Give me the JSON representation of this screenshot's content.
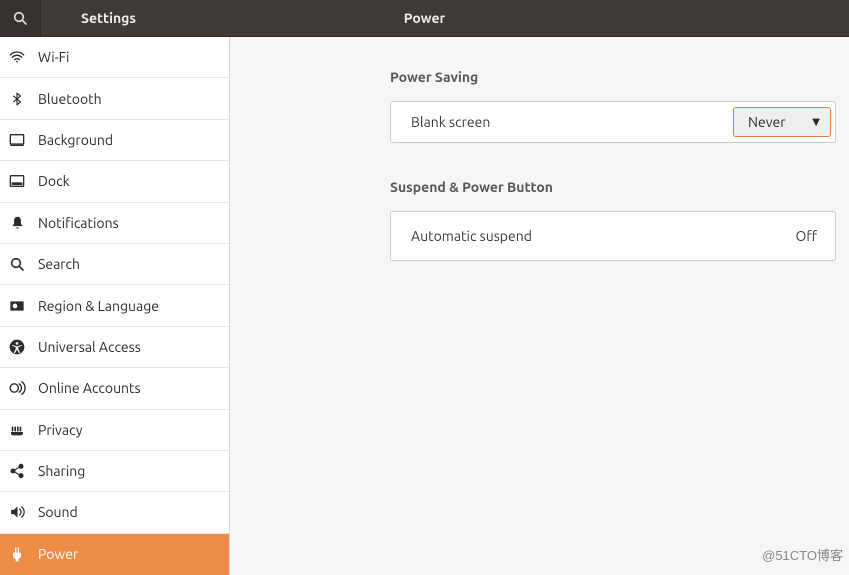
{
  "header": {
    "app_title": "Settings",
    "panel_title": "Power"
  },
  "sidebar": {
    "items": [
      {
        "label": "Wi-Fi"
      },
      {
        "label": "Bluetooth"
      },
      {
        "label": "Background"
      },
      {
        "label": "Dock"
      },
      {
        "label": "Notifications"
      },
      {
        "label": "Search"
      },
      {
        "label": "Region & Language"
      },
      {
        "label": "Universal Access"
      },
      {
        "label": "Online Accounts"
      },
      {
        "label": "Privacy"
      },
      {
        "label": "Sharing"
      },
      {
        "label": "Sound"
      },
      {
        "label": "Power"
      }
    ],
    "selected_index": 12
  },
  "power": {
    "section_saving_title": "Power Saving",
    "blank_screen": {
      "label": "Blank screen",
      "value": "Never"
    },
    "section_suspend_title": "Suspend & Power Button",
    "automatic_suspend": {
      "label": "Automatic suspend",
      "value": "Off"
    }
  },
  "watermark": "@51CTO博客"
}
